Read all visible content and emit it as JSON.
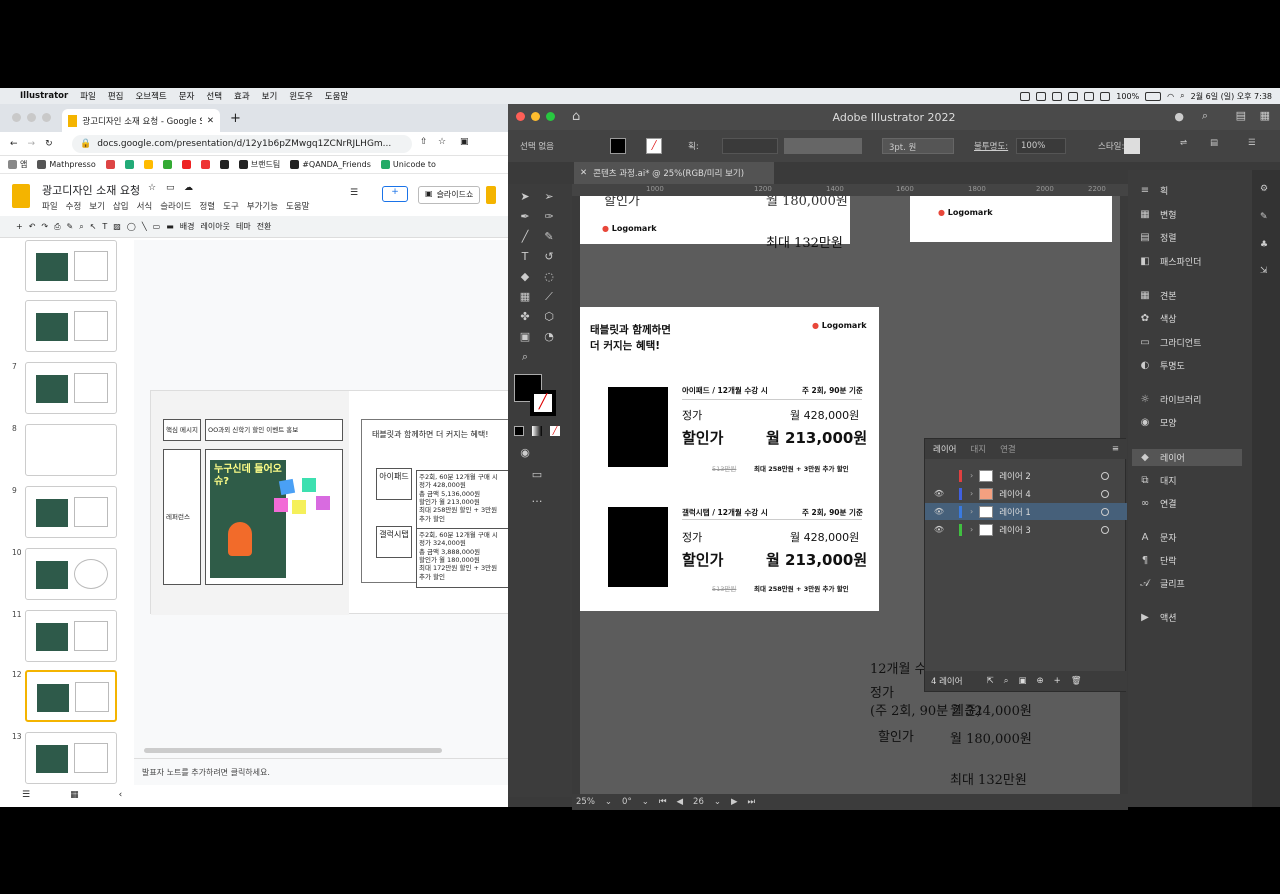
{
  "menubar": {
    "app": "Illustrator",
    "items": [
      "파일",
      "편집",
      "오브젝트",
      "문자",
      "선택",
      "효과",
      "보기",
      "윈도우",
      "도움말"
    ],
    "battery": "100%",
    "datetime": "2월 6일 (일) 오후 7:38"
  },
  "chrome": {
    "tab_title": "광고디자인 소재 요청 - Google Sli",
    "url": "docs.google.com/presentation/d/12y1b6pZMwgq1ZCNrRJLHGm...",
    "bookmarks": [
      "앱",
      "Mathpresso",
      "브랜드팀",
      "#QANDA_Friends",
      "Unicode to"
    ],
    "doc_title": "광고디자인 소재 요청",
    "doc_menu": [
      "파일",
      "수정",
      "보기",
      "삽입",
      "서식",
      "슬라이드",
      "정렬",
      "도구",
      "부가기능",
      "도움말"
    ],
    "slideshow": "슬라이드쇼",
    "toolbar": [
      "배경",
      "레이아웃",
      "테마",
      "전환"
    ],
    "slide_numbers": [
      "7",
      "8",
      "9",
      "10",
      "11",
      "12",
      "13"
    ],
    "notes": "발표자 노트를 추가하려면 클릭하세요."
  },
  "slide": {
    "core_label": "핵심 메시지",
    "core_value": "OO과외 신학기 할인 이벤트 홍보",
    "reference": "레퍼런스",
    "book_title": "누구신데 들어오슈?",
    "right_title": "태블릿과 함께하면 더 커지는 혜택!",
    "ipad": "아이패드",
    "ipad_text": "주2회, 60분 12개월 구매 시\n정가 428,000원\n총 금액 5,136,000원\n할인가 월 213,000원\n최대 258만원 할인 + 3만원\n추가 할인",
    "galaxy": "갤럭시탭",
    "galaxy_text": "주2회, 60분 12개월 구매 시\n정가 324,000원\n총 금액 3,888,000원\n할인가 월 180,000원\n최대 172만원 할인 + 3만원\n추가 할인"
  },
  "illustrator": {
    "title": "Adobe Illustrator 2022",
    "selection": "선택 없음",
    "stroke_label": "획:",
    "brush": "3pt. 원",
    "opacity_label": "불투명도:",
    "opacity": "100%",
    "style_label": "스타일:",
    "doc_tab": "콘텐츠 과정.ai* @ 25%(RGB/미리 보기)",
    "ruler": [
      "1000",
      "1200",
      "1400",
      "1600",
      "1800",
      "2000",
      "2200"
    ],
    "zoom": "25%",
    "rotate": "0°",
    "artboard_no": "26"
  },
  "artboards": {
    "top_price": "월 180,000원",
    "top_max": "최대 132만원",
    "top_partial": "할인가",
    "logomark": "Logomark",
    "headline": "태블릿과 함께하면\n더 커지는 혜택!",
    "row1_head": "아이패드 / 12개월 수강 시",
    "row1_freq": "주 2회, 90분 기준",
    "row2_head": "갤럭시탭 / 12개월 수강 시",
    "row2_freq": "주 2회, 90분 기준",
    "list_label": "정가",
    "list_price": "월 428,000원",
    "sale_label": "할인가",
    "sale_price": "월 213,000원",
    "strike": "513만원",
    "footnote": "최대 258만원 + 3만원 추가 할인",
    "loose_1": "12개월 수",
    "loose_2": "정가",
    "loose_3": "(주 2회, 90분 기준)",
    "loose_3b": "월 324,000원",
    "loose_4": "할인가",
    "loose_5": "월 180,000원",
    "loose_6": "최대 132만원"
  },
  "right_panel": [
    "획",
    "변형",
    "정렬",
    "패스파인더",
    "견본",
    "색상",
    "그라디언트",
    "투명도",
    "라이브러리",
    "모양",
    "레이어",
    "대지",
    "연결",
    "문자",
    "단락",
    "글리프",
    "액션"
  ],
  "layers_panel": {
    "tabs": [
      "레이어",
      "대지",
      "연결"
    ],
    "rows": [
      {
        "name": "레이어 2",
        "color": "#e04040",
        "visible": false
      },
      {
        "name": "레이어 4",
        "color": "#4060e0",
        "visible": true
      },
      {
        "name": "레이어 1",
        "color": "#3a7ae0",
        "visible": true,
        "selected": true
      },
      {
        "name": "레이어 3",
        "color": "#40c040",
        "visible": true
      }
    ],
    "count": "4 레이어"
  }
}
